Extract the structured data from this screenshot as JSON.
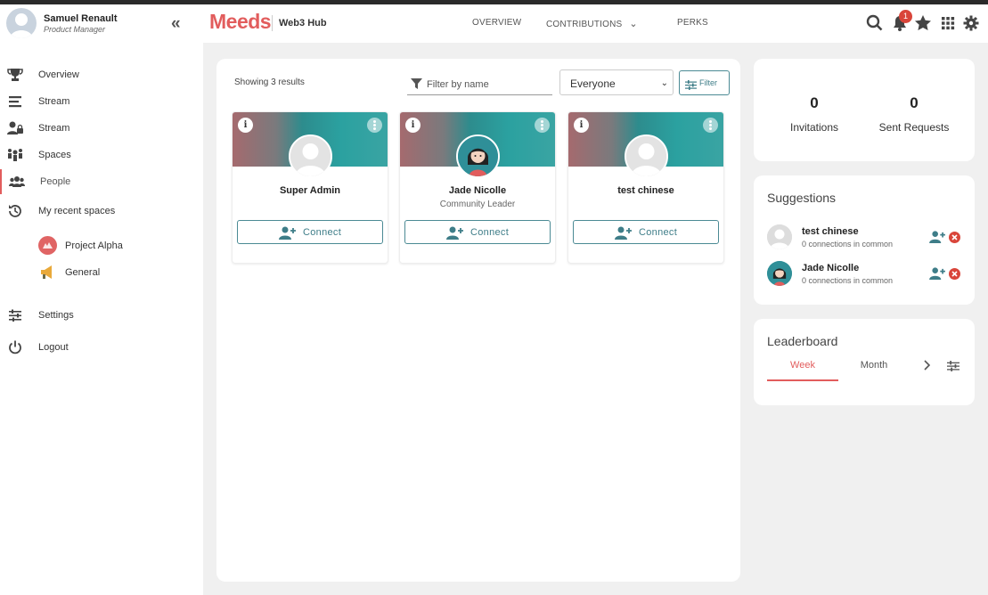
{
  "user": {
    "name": "Samuel Renault",
    "role": "Product Manager"
  },
  "sidebar": {
    "items": [
      {
        "label": "Overview"
      },
      {
        "label": "Stream"
      },
      {
        "label": "Stream"
      },
      {
        "label": "Spaces"
      },
      {
        "label": "People"
      },
      {
        "label": "My recent spaces"
      }
    ],
    "spaces": [
      {
        "label": "Project Alpha"
      },
      {
        "label": "General"
      }
    ],
    "settings": "Settings",
    "logout": "Logout"
  },
  "header": {
    "logo": "Meeds",
    "hub": "Web3 Hub",
    "nav": [
      "OVERVIEW",
      "CONTRIBUTIONS",
      "PERKS"
    ],
    "notifications_count": "1"
  },
  "people": {
    "results": "Showing 3 results",
    "filter_placeholder": "Filter by name",
    "select_value": "Everyone",
    "filter_button": "Filter",
    "cards": [
      {
        "name": "Super Admin",
        "role": "",
        "connect": "Connect"
      },
      {
        "name": "Jade Nicolle",
        "role": "Community Leader",
        "connect": "Connect"
      },
      {
        "name": "test chinese",
        "role": "",
        "connect": "Connect"
      }
    ]
  },
  "stats": {
    "invitations": {
      "count": "0",
      "label": "Invitations"
    },
    "sent": {
      "count": "0",
      "label": "Sent Requests"
    }
  },
  "suggestions": {
    "title": "Suggestions",
    "items": [
      {
        "name": "test chinese",
        "sub": "0 connections in common"
      },
      {
        "name": "Jade Nicolle",
        "sub": "0 connections in common"
      }
    ]
  },
  "leaderboard": {
    "title": "Leaderboard",
    "tabs": [
      "Week",
      "Month"
    ]
  },
  "colors": {
    "accent": "#e25d5d",
    "teal": "#3e7d88",
    "badge": "#d9453a"
  }
}
